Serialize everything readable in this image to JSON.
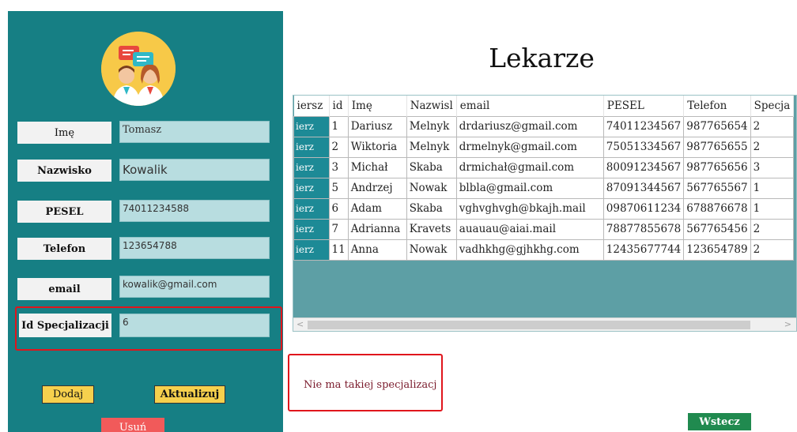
{
  "form": {
    "fields": [
      {
        "label": "Imę",
        "value": "Tomasz"
      },
      {
        "label": "Nazwisko",
        "value": "Kowalik"
      },
      {
        "label": "PESEL",
        "value": "74011234588"
      },
      {
        "label": "Telefon",
        "value": "123654788"
      },
      {
        "label": "email",
        "value": "kowalik@gmail.com"
      },
      {
        "label": "Id Specjalizacji",
        "value": "6"
      }
    ],
    "buttons": {
      "add": "Dodaj",
      "update": "Aktualizuj",
      "delete": "Usuń"
    }
  },
  "page": {
    "title": "Lekarze",
    "back_button": "Wstecz",
    "message": "Nie ma takiej specjalizacj"
  },
  "grid": {
    "columns": [
      "iersz",
      "id",
      "Imę",
      "Nazwisl",
      "email",
      "PESEL",
      "Telefon",
      "Specja"
    ],
    "button_label": "ierz",
    "rows": [
      [
        "1",
        "Dariusz",
        "Melnyk",
        "drdariusz@gmail.com",
        "74011234567",
        "987765654",
        "2"
      ],
      [
        "2",
        "Wiktoria",
        "Melnyk",
        "drmelnyk@gmail.com",
        "75051334567",
        "987765655",
        "2"
      ],
      [
        "3",
        "Michał",
        "Skaba",
        "drmichał@gmail.com",
        "80091234567",
        "987765656",
        "3"
      ],
      [
        "5",
        "Andrzej",
        "Nowak",
        "blbla@gmail.com",
        "87091344567",
        "567765567",
        "1"
      ],
      [
        "6",
        "Adam",
        "Skaba",
        "vghvghvgh@bkajh.mail",
        "09870611234",
        "678876678",
        "1"
      ],
      [
        "7",
        "Adrianna",
        "Kravets",
        "auauau@aiai.mail",
        "78877855678",
        "567765456",
        "2"
      ],
      [
        "11",
        "Anna",
        "Nowak",
        "vadhkhg@gjhkhg.com",
        "12435677744",
        "123654789",
        "2"
      ]
    ]
  },
  "colors": {
    "panel": "#167f84",
    "input_bg": "#b8dde0",
    "highlight": "#e0151c",
    "yellow_button": "#f6d04d",
    "delete_button": "#f15a5a",
    "back_button": "#208a4f"
  }
}
